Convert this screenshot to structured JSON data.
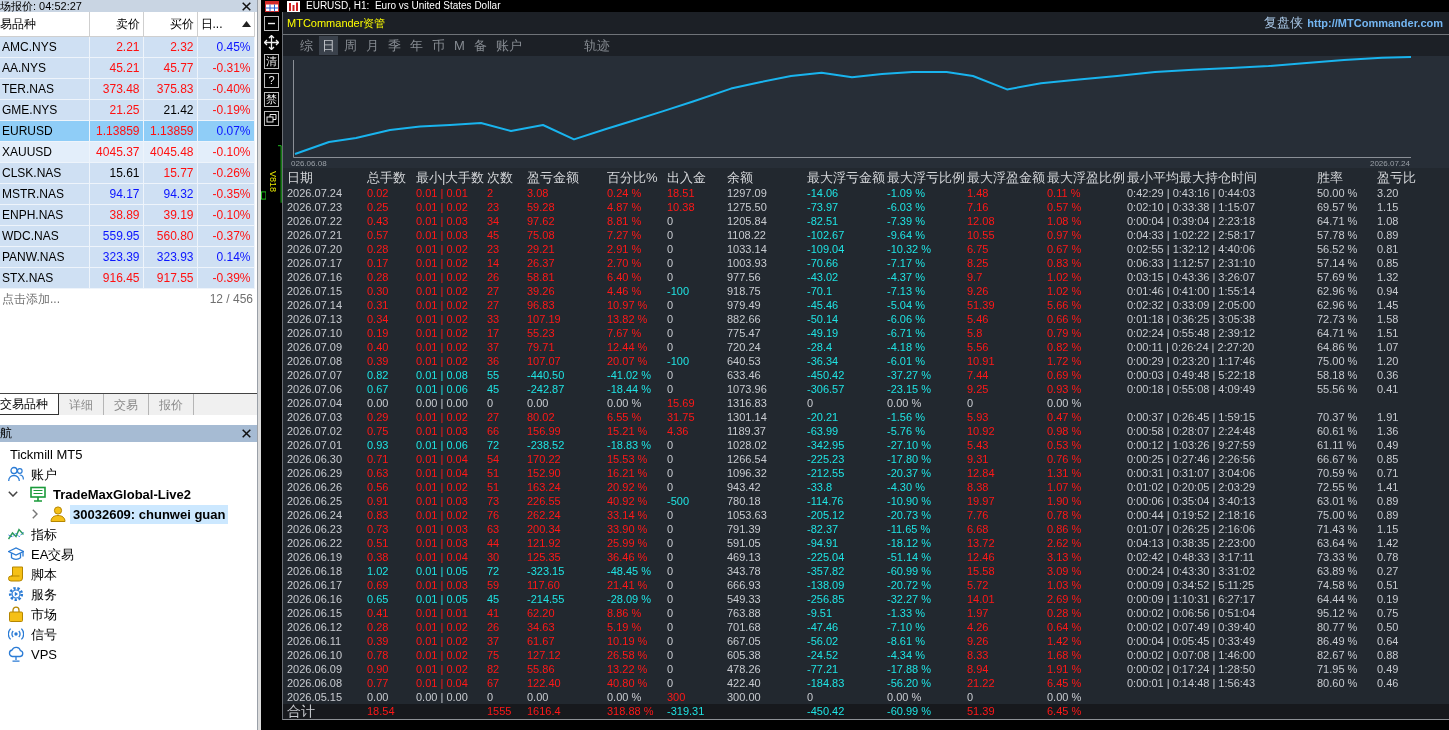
{
  "market_watch": {
    "title": "场报价: 04:52:27",
    "columns": [
      {
        "label": "易品种",
        "sorted": false
      },
      {
        "label": "卖价",
        "sorted": false
      },
      {
        "label": "买价",
        "sorted": false
      },
      {
        "label": "日...",
        "sorted": true
      }
    ],
    "rows": [
      {
        "symbol": "AMC.NYS",
        "bid": {
          "text": "2.21",
          "color": "#ff1010"
        },
        "ask": {
          "text": "2.32",
          "color": "#ff1010"
        },
        "change": {
          "text": "0.45%",
          "color": "#0a14ff"
        },
        "selected": false,
        "hovered": false
      },
      {
        "symbol": "AA.NYS",
        "bid": {
          "text": "45.21",
          "color": "#ff1010"
        },
        "ask": {
          "text": "45.77",
          "color": "#ff1010"
        },
        "change": {
          "text": "-0.31%",
          "color": "#ff1010"
        },
        "selected": false,
        "hovered": false
      },
      {
        "symbol": "TER.NAS",
        "bid": {
          "text": "373.48",
          "color": "#ff1010"
        },
        "ask": {
          "text": "375.83",
          "color": "#ff1010"
        },
        "change": {
          "text": "-0.40%",
          "color": "#ff1010"
        },
        "selected": false,
        "hovered": false
      },
      {
        "symbol": "GME.NYS",
        "bid": {
          "text": "21.25",
          "color": "#ff1010"
        },
        "ask": {
          "text": "21.42",
          "color": "#000000"
        },
        "change": {
          "text": "-0.19%",
          "color": "#ff1010"
        },
        "selected": false,
        "hovered": false
      },
      {
        "symbol": "EURUSD",
        "bid": {
          "text": "1.13859",
          "color": "#ff1010"
        },
        "ask": {
          "text": "1.13859",
          "color": "#ff1010"
        },
        "change": {
          "text": "0.07%",
          "color": "#0a14ff"
        },
        "selected": true,
        "hovered": false
      },
      {
        "symbol": "XAUUSD",
        "bid": {
          "text": "4045.37",
          "color": "#ff1010"
        },
        "ask": {
          "text": "4045.48",
          "color": "#ff1010"
        },
        "change": {
          "text": "-0.10%",
          "color": "#ff1010"
        },
        "selected": false,
        "hovered": true
      },
      {
        "symbol": "CLSK.NAS",
        "bid": {
          "text": "15.61",
          "color": "#000000"
        },
        "ask": {
          "text": "15.77",
          "color": "#ff1010"
        },
        "change": {
          "text": "-0.26%",
          "color": "#ff1010"
        },
        "selected": false,
        "hovered": false
      },
      {
        "symbol": "MSTR.NAS",
        "bid": {
          "text": "94.17",
          "color": "#0a14ff"
        },
        "ask": {
          "text": "94.32",
          "color": "#0a14ff"
        },
        "change": {
          "text": "-0.35%",
          "color": "#ff1010"
        },
        "selected": false,
        "hovered": false
      },
      {
        "symbol": "ENPH.NAS",
        "bid": {
          "text": "38.89",
          "color": "#ff1010"
        },
        "ask": {
          "text": "39.19",
          "color": "#ff1010"
        },
        "change": {
          "text": "-0.10%",
          "color": "#ff1010"
        },
        "selected": false,
        "hovered": false
      },
      {
        "symbol": "WDC.NAS",
        "bid": {
          "text": "559.95",
          "color": "#0a14ff"
        },
        "ask": {
          "text": "560.80",
          "color": "#ff1010"
        },
        "change": {
          "text": "-0.37%",
          "color": "#ff1010"
        },
        "selected": false,
        "hovered": false
      },
      {
        "symbol": "PANW.NAS",
        "bid": {
          "text": "323.39",
          "color": "#0a14ff"
        },
        "ask": {
          "text": "323.93",
          "color": "#0a14ff"
        },
        "change": {
          "text": "0.14%",
          "color": "#0a14ff"
        },
        "selected": false,
        "hovered": false
      },
      {
        "symbol": "STX.NAS",
        "bid": {
          "text": "916.45",
          "color": "#ff1010"
        },
        "ask": {
          "text": "917.55",
          "color": "#ff1010"
        },
        "change": {
          "text": "-0.39%",
          "color": "#ff1010"
        },
        "selected": false,
        "hovered": false
      }
    ],
    "footer": {
      "hint": "点击添加...",
      "count": "12 / 456"
    }
  },
  "panel_tabs": [
    {
      "label": "交易品种",
      "selected": true
    },
    {
      "label": "详细",
      "selected": false
    },
    {
      "label": "交易",
      "selected": false
    },
    {
      "label": "报价",
      "selected": false
    }
  ],
  "navigator": {
    "title": "航",
    "tree": [
      {
        "label": "Tickmill MT5",
        "selected": false,
        "children": [
          {
            "label": "账户",
            "kind": "accounts",
            "selected": false,
            "children": [
              {
                "label": "TradeMaxGlobal-Live2",
                "kind": "server",
                "expanded": true,
                "selected": false,
                "children": [
                  {
                    "label": "30032609: chunwei guan",
                    "kind": "account",
                    "expanded": false,
                    "selected": true
                  }
                ]
              }
            ]
          },
          {
            "label": "指标",
            "kind": "indicators",
            "selected": false
          },
          {
            "label": "EA交易",
            "kind": "experts",
            "selected": false
          },
          {
            "label": "脚本",
            "kind": "scripts",
            "selected": false
          },
          {
            "label": "服务",
            "kind": "services",
            "selected": false
          },
          {
            "label": "市场",
            "kind": "market",
            "selected": false
          },
          {
            "label": "信号",
            "kind": "signals",
            "selected": false
          },
          {
            "label": "VPS",
            "kind": "vps",
            "selected": false
          }
        ]
      }
    ]
  },
  "chart_window": {
    "title": "EURUSD, H1:  Euro vs United States Dollar",
    "toolbar": [
      {
        "kind": "minimize"
      },
      {
        "kind": "move"
      },
      {
        "kind": "glyph",
        "label": "清"
      },
      {
        "kind": "glyph",
        "label": "?"
      },
      {
        "kind": "glyph",
        "label": "禁"
      },
      {
        "kind": "restore"
      }
    ],
    "indicator_label": "V818"
  },
  "commander": {
    "brand": "MTCommander资管",
    "author": "复盘侠",
    "link": "http://MTCommander.com",
    "tab_groups": [
      {
        "tabs": [
          {
            "label": "综",
            "selected": false
          },
          {
            "label": "日",
            "selected": true
          },
          {
            "label": "周",
            "selected": false
          },
          {
            "label": "月",
            "selected": false
          },
          {
            "label": "季",
            "selected": false
          },
          {
            "label": "年",
            "selected": false
          },
          {
            "label": "币",
            "selected": false
          },
          {
            "label": "M",
            "selected": false
          },
          {
            "label": "备",
            "selected": false
          },
          {
            "label": "账户",
            "selected": false
          }
        ]
      },
      {
        "tabs": [
          {
            "label": "轨迹",
            "selected": false
          }
        ]
      }
    ],
    "chart": {
      "start_label": "026.06.08",
      "end_label": "2026.07.24"
    },
    "table": {
      "columns": [
        "日期",
        "总手数",
        "最小|大手数",
        "次数",
        "盈亏金额",
        "百分比%",
        "出入金",
        "余额",
        "最大浮亏金额",
        "最大浮亏比例",
        "最大浮盈金额",
        "最大浮盈比例",
        "最小平均最大持仓时间",
        "胜率",
        "盈亏比"
      ],
      "rows": [
        {
          "cells": [
            "2026.07.24",
            "0.02",
            "0.01 | 0.01",
            "2",
            "3.08",
            "0.24 %",
            "18.51",
            "1297.09",
            "-14.06",
            "-1.09 %",
            "1.48",
            "0.11 %",
            "0:42:29 | 0:43:16 | 0:44:03",
            "50.00 %",
            "3.20"
          ],
          "kind": "gain",
          "deposit": true,
          "withdrawal": false
        },
        {
          "cells": [
            "2026.07.23",
            "0.25",
            "0.01 | 0.02",
            "23",
            "59.28",
            "4.87 %",
            "10.38",
            "1275.50",
            "-73.97",
            "-6.03 %",
            "7.16",
            "0.57 %",
            "0:02:10 | 0:33:38 | 1:15:07",
            "69.57 %",
            "1.15"
          ],
          "kind": "gain",
          "deposit": true,
          "withdrawal": false
        },
        {
          "cells": [
            "2026.07.22",
            "0.43",
            "0.01 | 0.03",
            "34",
            "97.62",
            "8.81 %",
            "0",
            "1205.84",
            "-82.51",
            "-7.39 %",
            "12.08",
            "1.08 %",
            "0:00:04 | 0:39:04 | 2:23:18",
            "64.71 %",
            "1.08"
          ],
          "kind": "gain",
          "deposit": false,
          "withdrawal": false
        },
        {
          "cells": [
            "2026.07.21",
            "0.57",
            "0.01 | 0.03",
            "45",
            "75.08",
            "7.27 %",
            "0",
            "1108.22",
            "-102.67",
            "-9.64 %",
            "10.55",
            "0.97 %",
            "0:04:33 | 1:02:22 | 2:58:17",
            "57.78 %",
            "0.89"
          ],
          "kind": "gain",
          "deposit": false,
          "withdrawal": false
        },
        {
          "cells": [
            "2026.07.20",
            "0.28",
            "0.01 | 0.02",
            "23",
            "29.21",
            "2.91 %",
            "0",
            "1033.14",
            "-109.04",
            "-10.32 %",
            "6.75",
            "0.67 %",
            "0:02:55 | 1:32:12 | 4:40:06",
            "56.52 %",
            "0.81"
          ],
          "kind": "gain",
          "deposit": false,
          "withdrawal": false
        },
        {
          "cells": [
            "2026.07.17",
            "0.17",
            "0.01 | 0.02",
            "14",
            "26.37",
            "2.70 %",
            "0",
            "1003.93",
            "-70.66",
            "-7.17 %",
            "8.25",
            "0.83 %",
            "0:06:33 | 1:12:57 | 2:31:10",
            "57.14 %",
            "0.85"
          ],
          "kind": "gain",
          "deposit": false,
          "withdrawal": false
        },
        {
          "cells": [
            "2026.07.16",
            "0.28",
            "0.01 | 0.02",
            "26",
            "58.81",
            "6.40 %",
            "0",
            "977.56",
            "-43.02",
            "-4.37 %",
            "9.7",
            "1.02 %",
            "0:03:15 | 0:43:36 | 3:26:07",
            "57.69 %",
            "1.32"
          ],
          "kind": "gain",
          "deposit": false,
          "withdrawal": false
        },
        {
          "cells": [
            "2026.07.15",
            "0.30",
            "0.01 | 0.02",
            "27",
            "39.26",
            "4.46 %",
            "-100",
            "918.75",
            "-70.1",
            "-7.13 %",
            "9.26",
            "1.02 %",
            "0:01:46 | 0:41:00 | 1:55:14",
            "62.96 %",
            "0.94"
          ],
          "kind": "gain",
          "deposit": false,
          "withdrawal": true
        },
        {
          "cells": [
            "2026.07.14",
            "0.31",
            "0.01 | 0.02",
            "27",
            "96.83",
            "10.97 %",
            "0",
            "979.49",
            "-45.46",
            "-5.04 %",
            "51.39",
            "5.66 %",
            "0:02:32 | 0:33:09 | 2:05:00",
            "62.96 %",
            "1.45"
          ],
          "kind": "gain",
          "deposit": false,
          "withdrawal": false
        },
        {
          "cells": [
            "2026.07.13",
            "0.34",
            "0.01 | 0.02",
            "33",
            "107.19",
            "13.82 %",
            "0",
            "882.66",
            "-50.14",
            "-6.06 %",
            "5.46",
            "0.66 %",
            "0:01:18 | 0:36:25 | 3:05:38",
            "72.73 %",
            "1.58"
          ],
          "kind": "gain",
          "deposit": false,
          "withdrawal": false
        },
        {
          "cells": [
            "2026.07.10",
            "0.19",
            "0.01 | 0.02",
            "17",
            "55.23",
            "7.67 %",
            "0",
            "775.47",
            "-49.19",
            "-6.71 %",
            "5.8",
            "0.79 %",
            "0:02:24 | 0:55:48 | 2:39:12",
            "64.71 %",
            "1.51"
          ],
          "kind": "gain",
          "deposit": false,
          "withdrawal": false
        },
        {
          "cells": [
            "2026.07.09",
            "0.40",
            "0.01 | 0.02",
            "37",
            "79.71",
            "12.44 %",
            "0",
            "720.24",
            "-28.4",
            "-4.18 %",
            "5.56",
            "0.82 %",
            "0:00:11 | 0:26:24 | 2:27:20",
            "64.86 %",
            "1.07"
          ],
          "kind": "gain",
          "deposit": false,
          "withdrawal": false
        },
        {
          "cells": [
            "2026.07.08",
            "0.39",
            "0.01 | 0.02",
            "36",
            "107.07",
            "20.07 %",
            "-100",
            "640.53",
            "-36.34",
            "-6.01 %",
            "10.91",
            "1.72 %",
            "0:00:29 | 0:23:20 | 1:17:46",
            "75.00 %",
            "1.20"
          ],
          "kind": "gain",
          "deposit": false,
          "withdrawal": true
        },
        {
          "cells": [
            "2026.07.07",
            "0.82",
            "0.01 | 0.08",
            "55",
            "-440.50",
            "-41.02 %",
            "0",
            "633.46",
            "-450.42",
            "-37.27 %",
            "7.44",
            "0.69 %",
            "0:00:03 | 0:49:48 | 5:22:18",
            "58.18 %",
            "0.36"
          ],
          "kind": "loss",
          "deposit": false,
          "withdrawal": false
        },
        {
          "cells": [
            "2026.07.06",
            "0.67",
            "0.01 | 0.06",
            "45",
            "-242.87",
            "-18.44 %",
            "0",
            "1073.96",
            "-306.57",
            "-23.15 %",
            "9.25",
            "0.93 %",
            "0:00:18 | 0:55:08 | 4:09:49",
            "55.56 %",
            "0.41"
          ],
          "kind": "loss",
          "deposit": false,
          "withdrawal": false
        },
        {
          "cells": [
            "2026.07.04",
            "0.00",
            "0.00 | 0.00",
            "0",
            "0.00",
            "0.00 %",
            "15.69",
            "1316.83",
            "0",
            "0.00 %",
            "0",
            "0.00 %"
          ],
          "kind": "flat",
          "deposit": true,
          "withdrawal": false
        },
        {
          "cells": [
            "2026.07.03",
            "0.29",
            "0.01 | 0.02",
            "27",
            "80.02",
            "6.55 %",
            "31.75",
            "1301.14",
            "-20.21",
            "-1.56 %",
            "5.93",
            "0.47 %",
            "0:00:37 | 0:26:45 | 1:59:15",
            "70.37 %",
            "1.91"
          ],
          "kind": "gain",
          "deposit": true,
          "withdrawal": false
        },
        {
          "cells": [
            "2026.07.02",
            "0.75",
            "0.01 | 0.03",
            "66",
            "156.99",
            "15.21 %",
            "4.36",
            "1189.37",
            "-63.99",
            "-5.76 %",
            "10.92",
            "0.98 %",
            "0:00:58 | 0:28:07 | 2:24:48",
            "60.61 %",
            "1.36"
          ],
          "kind": "gain",
          "deposit": true,
          "withdrawal": false
        },
        {
          "cells": [
            "2026.07.01",
            "0.93",
            "0.01 | 0.06",
            "72",
            "-238.52",
            "-18.83 %",
            "0",
            "1028.02",
            "-342.95",
            "-27.10 %",
            "5.43",
            "0.53 %",
            "0:00:12 | 1:03:26 | 9:27:59",
            "61.11 %",
            "0.49"
          ],
          "kind": "loss",
          "deposit": false,
          "withdrawal": false
        },
        {
          "cells": [
            "2026.06.30",
            "0.71",
            "0.01 | 0.04",
            "54",
            "170.22",
            "15.53 %",
            "0",
            "1266.54",
            "-225.23",
            "-17.80 %",
            "9.31",
            "0.76 %",
            "0:00:25 | 0:27:46 | 2:26:56",
            "66.67 %",
            "0.85"
          ],
          "kind": "gain",
          "deposit": false,
          "withdrawal": false
        },
        {
          "cells": [
            "2026.06.29",
            "0.63",
            "0.01 | 0.04",
            "51",
            "152.90",
            "16.21 %",
            "0",
            "1096.32",
            "-212.55",
            "-20.37 %",
            "12.84",
            "1.31 %",
            "0:00:31 | 0:31:07 | 3:04:06",
            "70.59 %",
            "0.71"
          ],
          "kind": "gain",
          "deposit": false,
          "withdrawal": false
        },
        {
          "cells": [
            "2026.06.26",
            "0.56",
            "0.01 | 0.02",
            "51",
            "163.24",
            "20.92 %",
            "0",
            "943.42",
            "-33.8",
            "-4.30 %",
            "8.38",
            "1.07 %",
            "0:01:02 | 0:20:05 | 2:03:29",
            "72.55 %",
            "1.41"
          ],
          "kind": "gain",
          "deposit": false,
          "withdrawal": false
        },
        {
          "cells": [
            "2026.06.25",
            "0.91",
            "0.01 | 0.03",
            "73",
            "226.55",
            "40.92 %",
            "-500",
            "780.18",
            "-114.76",
            "-10.90 %",
            "19.97",
            "1.90 %",
            "0:00:06 | 0:35:04 | 3:40:13",
            "63.01 %",
            "0.89"
          ],
          "kind": "gain",
          "deposit": false,
          "withdrawal": true
        },
        {
          "cells": [
            "2026.06.24",
            "0.83",
            "0.01 | 0.02",
            "76",
            "262.24",
            "33.14 %",
            "0",
            "1053.63",
            "-205.12",
            "-20.73 %",
            "7.76",
            "0.78 %",
            "0:00:44 | 0:19:52 | 2:18:16",
            "75.00 %",
            "0.89"
          ],
          "kind": "gain",
          "deposit": false,
          "withdrawal": false
        },
        {
          "cells": [
            "2026.06.23",
            "0.73",
            "0.01 | 0.03",
            "63",
            "200.34",
            "33.90 %",
            "0",
            "791.39",
            "-82.37",
            "-11.65 %",
            "6.68",
            "0.86 %",
            "0:01:07 | 0:26:25 | 2:16:06",
            "71.43 %",
            "1.15"
          ],
          "kind": "gain",
          "deposit": false,
          "withdrawal": false
        },
        {
          "cells": [
            "2026.06.22",
            "0.51",
            "0.01 | 0.03",
            "44",
            "121.92",
            "25.99 %",
            "0",
            "591.05",
            "-94.91",
            "-18.12 %",
            "13.72",
            "2.62 %",
            "0:04:13 | 0:38:35 | 2:23:00",
            "63.64 %",
            "1.42"
          ],
          "kind": "gain",
          "deposit": false,
          "withdrawal": false
        },
        {
          "cells": [
            "2026.06.19",
            "0.38",
            "0.01 | 0.04",
            "30",
            "125.35",
            "36.46 %",
            "0",
            "469.13",
            "-225.04",
            "-51.14 %",
            "12.46",
            "3.13 %",
            "0:02:42 | 0:48:33 | 3:17:11",
            "73.33 %",
            "0.78"
          ],
          "kind": "gain",
          "deposit": false,
          "withdrawal": false
        },
        {
          "cells": [
            "2026.06.18",
            "1.02",
            "0.01 | 0.05",
            "72",
            "-323.15",
            "-48.45 %",
            "0",
            "343.78",
            "-357.82",
            "-60.99 %",
            "15.58",
            "3.09 %",
            "0:00:24 | 0:43:30 | 3:31:02",
            "63.89 %",
            "0.27"
          ],
          "kind": "loss",
          "deposit": false,
          "withdrawal": false
        },
        {
          "cells": [
            "2026.06.17",
            "0.69",
            "0.01 | 0.03",
            "59",
            "117.60",
            "21.41 %",
            "0",
            "666.93",
            "-138.09",
            "-20.72 %",
            "5.72",
            "1.03 %",
            "0:00:09 | 0:34:52 | 5:11:25",
            "74.58 %",
            "0.51"
          ],
          "kind": "gain",
          "deposit": false,
          "withdrawal": false
        },
        {
          "cells": [
            "2026.06.16",
            "0.65",
            "0.01 | 0.05",
            "45",
            "-214.55",
            "-28.09 %",
            "0",
            "549.33",
            "-256.85",
            "-32.27 %",
            "14.01",
            "2.69 %",
            "0:00:09 | 1:10:31 | 6:27:17",
            "64.44 %",
            "0.19"
          ],
          "kind": "loss",
          "deposit": false,
          "withdrawal": false
        },
        {
          "cells": [
            "2026.06.15",
            "0.41",
            "0.01 | 0.01",
            "41",
            "62.20",
            "8.86 %",
            "0",
            "763.88",
            "-9.51",
            "-1.33 %",
            "1.97",
            "0.28 %",
            "0:00:02 | 0:06:56 | 0:51:04",
            "95.12 %",
            "0.75"
          ],
          "kind": "gain",
          "deposit": false,
          "withdrawal": false
        },
        {
          "cells": [
            "2026.06.12",
            "0.28",
            "0.01 | 0.02",
            "26",
            "34.63",
            "5.19 %",
            "0",
            "701.68",
            "-47.46",
            "-7.10 %",
            "4.26",
            "0.64 %",
            "0:00:02 | 0:07:49 | 0:39:40",
            "80.77 %",
            "0.50"
          ],
          "kind": "gain",
          "deposit": false,
          "withdrawal": false
        },
        {
          "cells": [
            "2026.06.11",
            "0.39",
            "0.01 | 0.02",
            "37",
            "61.67",
            "10.19 %",
            "0",
            "667.05",
            "-56.02",
            "-8.61 %",
            "9.26",
            "1.42 %",
            "0:00:04 | 0:05:45 | 0:33:49",
            "86.49 %",
            "0.64"
          ],
          "kind": "gain",
          "deposit": false,
          "withdrawal": false
        },
        {
          "cells": [
            "2026.06.10",
            "0.78",
            "0.01 | 0.02",
            "75",
            "127.12",
            "26.58 %",
            "0",
            "605.38",
            "-24.52",
            "-4.34 %",
            "8.33",
            "1.68 %",
            "0:00:02 | 0:07:08 | 1:46:00",
            "82.67 %",
            "0.88"
          ],
          "kind": "gain",
          "deposit": false,
          "withdrawal": false
        },
        {
          "cells": [
            "2026.06.09",
            "0.90",
            "0.01 | 0.02",
            "82",
            "55.86",
            "13.22 %",
            "0",
            "478.26",
            "-77.21",
            "-17.88 %",
            "8.94",
            "1.91 %",
            "0:00:02 | 0:17:24 | 1:28:50",
            "71.95 %",
            "0.49"
          ],
          "kind": "gain",
          "deposit": false,
          "withdrawal": false
        },
        {
          "cells": [
            "2026.06.08",
            "0.77",
            "0.01 | 0.04",
            "67",
            "122.40",
            "40.80 %",
            "0",
            "422.40",
            "-184.83",
            "-56.20 %",
            "21.22",
            "6.45 %",
            "0:00:01 | 0:14:48 | 1:56:43",
            "80.60 %",
            "0.46"
          ],
          "kind": "gain",
          "deposit": false,
          "withdrawal": false
        },
        {
          "cells": [
            "2026.05.15",
            "0.00",
            "0.00 | 0.00",
            "0",
            "0.00",
            "0.00 %",
            "300",
            "300.00",
            "0",
            "0.00 %",
            "0",
            "0.00 %"
          ],
          "kind": "flat",
          "deposit": true,
          "withdrawal": false
        }
      ],
      "total": {
        "label": "合计",
        "lots": "18.54",
        "trades": "1555",
        "profit": "1616.4",
        "percent": "318.88 %",
        "cash_flow": "-319.31",
        "max_float_loss": "-450.42",
        "max_float_loss_pct": "-60.99 %",
        "max_float_gain": "51.39",
        "max_float_gain_pct": "6.45 %",
        "kind": "gain",
        "deposit": false,
        "withdrawal": true
      }
    }
  }
}
